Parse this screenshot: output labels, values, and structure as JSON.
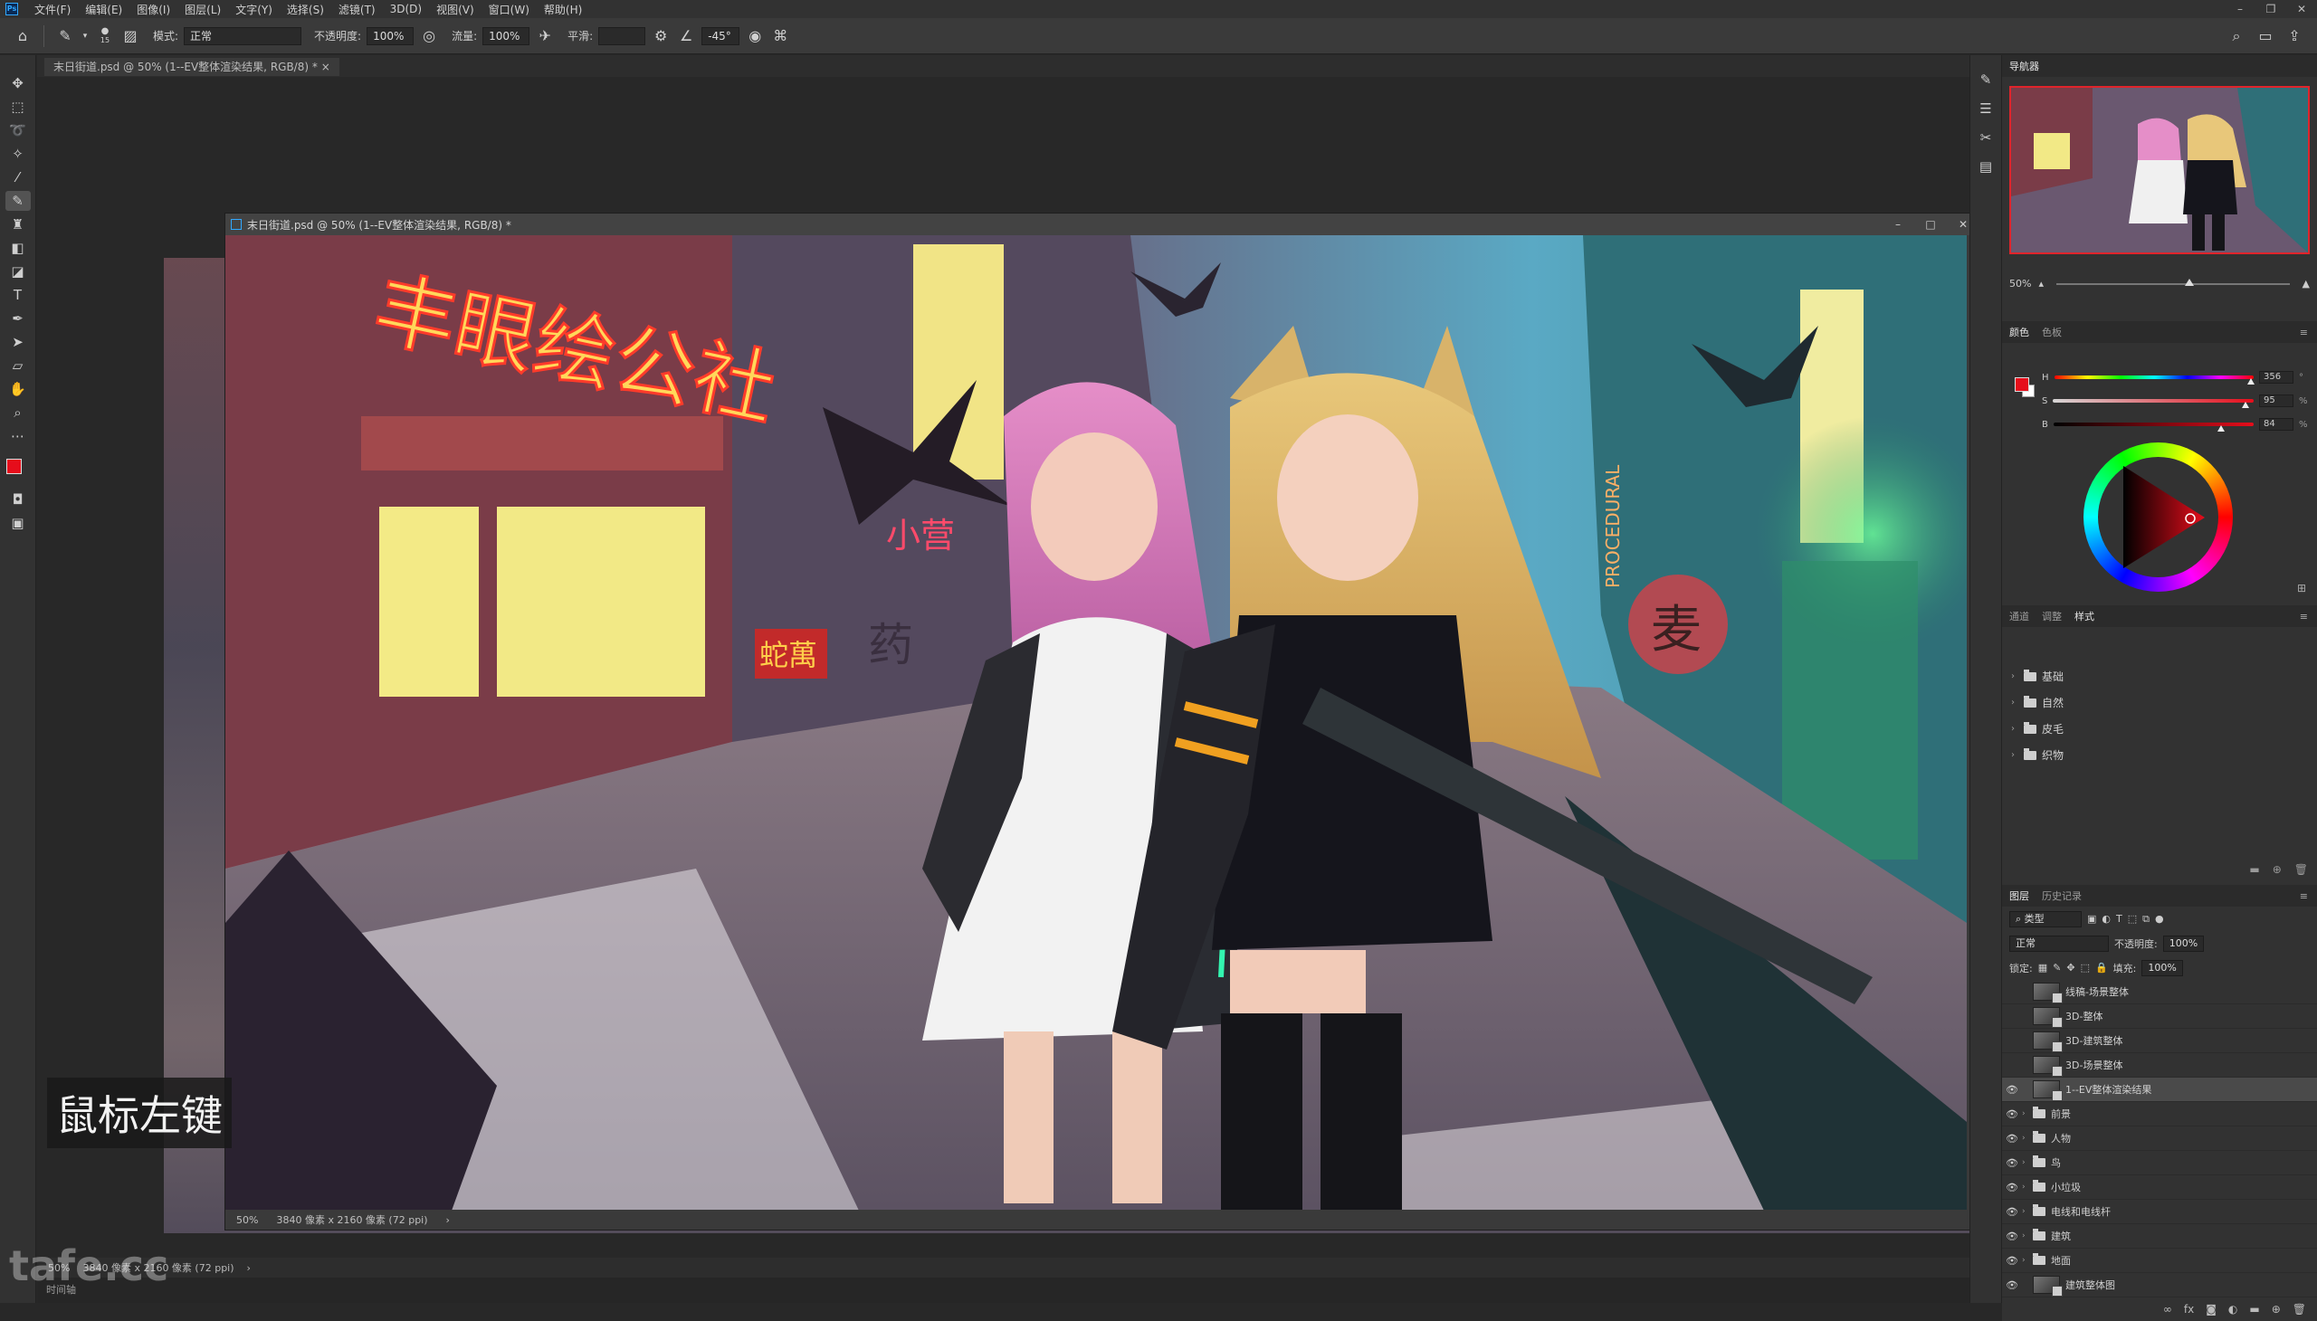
{
  "menubar": {
    "logo": "Ps",
    "items": [
      "文件(F)",
      "编辑(E)",
      "图像(I)",
      "图层(L)",
      "文字(Y)",
      "选择(S)",
      "滤镜(T)",
      "3D(D)",
      "视图(V)",
      "窗口(W)",
      "帮助(H)"
    ]
  },
  "options": {
    "brush_size": "15",
    "mode_label": "模式:",
    "mode_value": "正常",
    "opacity_label": "不透明度:",
    "opacity_value": "100%",
    "flow_label": "流量:",
    "flow_value": "100%",
    "smooth_label": "平滑:",
    "smooth_value": "",
    "angle_value": "-45°"
  },
  "document": {
    "tab_title": "末日街道.psd @ 50% (1--EV整体渲染结果, RGB/8) *",
    "window_title": "末日街道.psd @ 50% (1--EV整体渲染结果, RGB/8) *",
    "zoom": "50%",
    "doc_size": "3840 像素 x 2160 像素 (72 ppi)"
  },
  "bottom_status": {
    "zoom": "50%",
    "doc_size": "3840 像素 x 2160 像素 (72 ppi)",
    "timeline": "时间轴"
  },
  "subtitle": "鼠标左键",
  "watermark": "tafe.cc",
  "canvas_signs": {
    "neon_sign": "丰眼绘公社",
    "small_sign": "小营",
    "medicine_sign": "药",
    "snake_sign": "蛇萬",
    "procedural_sign": "PROCEDURAL",
    "right_circle_sign": "麦"
  },
  "navigator": {
    "tab": "导航器",
    "zoom": "50%"
  },
  "color": {
    "tabs": [
      "颜色",
      "色板"
    ],
    "h_label": "H",
    "h_value": "356",
    "h_unit": "°",
    "s_label": "S",
    "s_value": "95",
    "s_unit": "%",
    "b_label": "B",
    "b_value": "84",
    "b_unit": "%",
    "foreground": "#e60d1b",
    "background": "#ffffff"
  },
  "styles": {
    "tabs": [
      "通道",
      "调整",
      "样式"
    ],
    "folders": [
      "基础",
      "自然",
      "皮毛",
      "织物"
    ]
  },
  "layers": {
    "tabs": [
      "图层",
      "历史记录"
    ],
    "filter_label": "类型",
    "blend_mode": "正常",
    "opacity_label": "不透明度:",
    "opacity_value": "100%",
    "lock_label": "锁定:",
    "fill_label": "填充:",
    "fill_value": "100%",
    "items": [
      {
        "name": "线稿-场景整体",
        "visible": false,
        "type": "layer"
      },
      {
        "name": "3D-整体",
        "visible": false,
        "type": "layer"
      },
      {
        "name": "3D-建筑整体",
        "visible": false,
        "type": "layer"
      },
      {
        "name": "3D-场景整体",
        "visible": false,
        "type": "layer"
      },
      {
        "name": "1--EV整体渲染结果",
        "visible": true,
        "type": "layer",
        "selected": true
      },
      {
        "name": "前景",
        "visible": true,
        "type": "group"
      },
      {
        "name": "人物",
        "visible": true,
        "type": "group"
      },
      {
        "name": "鸟",
        "visible": true,
        "type": "group"
      },
      {
        "name": "小垃圾",
        "visible": true,
        "type": "group"
      },
      {
        "name": "电线和电线杆",
        "visible": true,
        "type": "group"
      },
      {
        "name": "建筑",
        "visible": true,
        "type": "group"
      },
      {
        "name": "地面",
        "visible": true,
        "type": "group"
      },
      {
        "name": "建筑整体图",
        "visible": true,
        "type": "layer"
      }
    ]
  }
}
